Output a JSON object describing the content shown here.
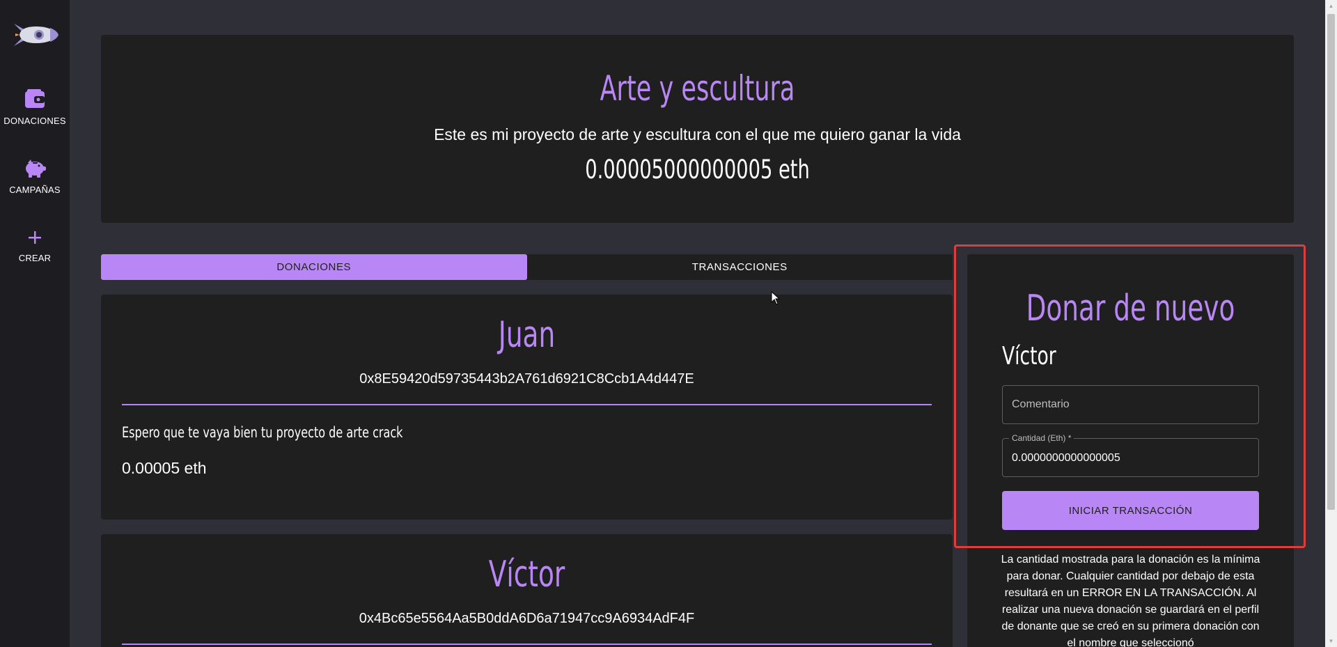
{
  "colors": {
    "accent": "#b987f5",
    "background": "#2f2f37",
    "card": "#1f1f1f",
    "sidebar": "#1d1d21",
    "highlight": "#e03c3c"
  },
  "sidebar": {
    "logo_icon": "rocket-icon",
    "items": [
      {
        "label": "DONACIONES",
        "icon": "wallet-icon"
      },
      {
        "label": "CAMPAÑAS",
        "icon": "piggy-bank-icon"
      },
      {
        "label": "CREAR",
        "icon": "plus-icon"
      }
    ]
  },
  "campaign": {
    "title": "Arte y escultura",
    "description": "Este es mi proyecto de arte y escultura con el que me quiero ganar la vida",
    "amount": "0.00005000000005 eth"
  },
  "tabs": [
    {
      "label": "DONACIONES",
      "active": true
    },
    {
      "label": "TRANSACCIONES",
      "active": false
    }
  ],
  "donations": [
    {
      "name": "Juan",
      "address": "0x8E59420d59735443b2A761d6921C8Ccb1A4d447E",
      "comment": "Espero que te vaya bien tu proyecto de arte crack",
      "amount": "0.00005 eth"
    },
    {
      "name": "Víctor",
      "address": "0x4Bc65e5564Aa5B0ddA6D6a71947cc9A6934AdF4F"
    }
  ],
  "form": {
    "title": "Donar de nuevo",
    "donor_name": "Víctor",
    "comment_placeholder": "Comentario",
    "amount_label": "Cantidad (Eth) *",
    "amount_value": "0.0000000000000005",
    "submit_label": "INICIAR TRANSACCIÓN",
    "notice": "La cantidad mostrada para la donación es la mínima para donar. Cualquier cantidad por debajo de esta resultará en un ERROR EN LA TRANSACCIÓN. Al realizar una nueva donación se guardará en el perfil de donante que se creó en su primera donación con el nombre que seleccionó"
  }
}
